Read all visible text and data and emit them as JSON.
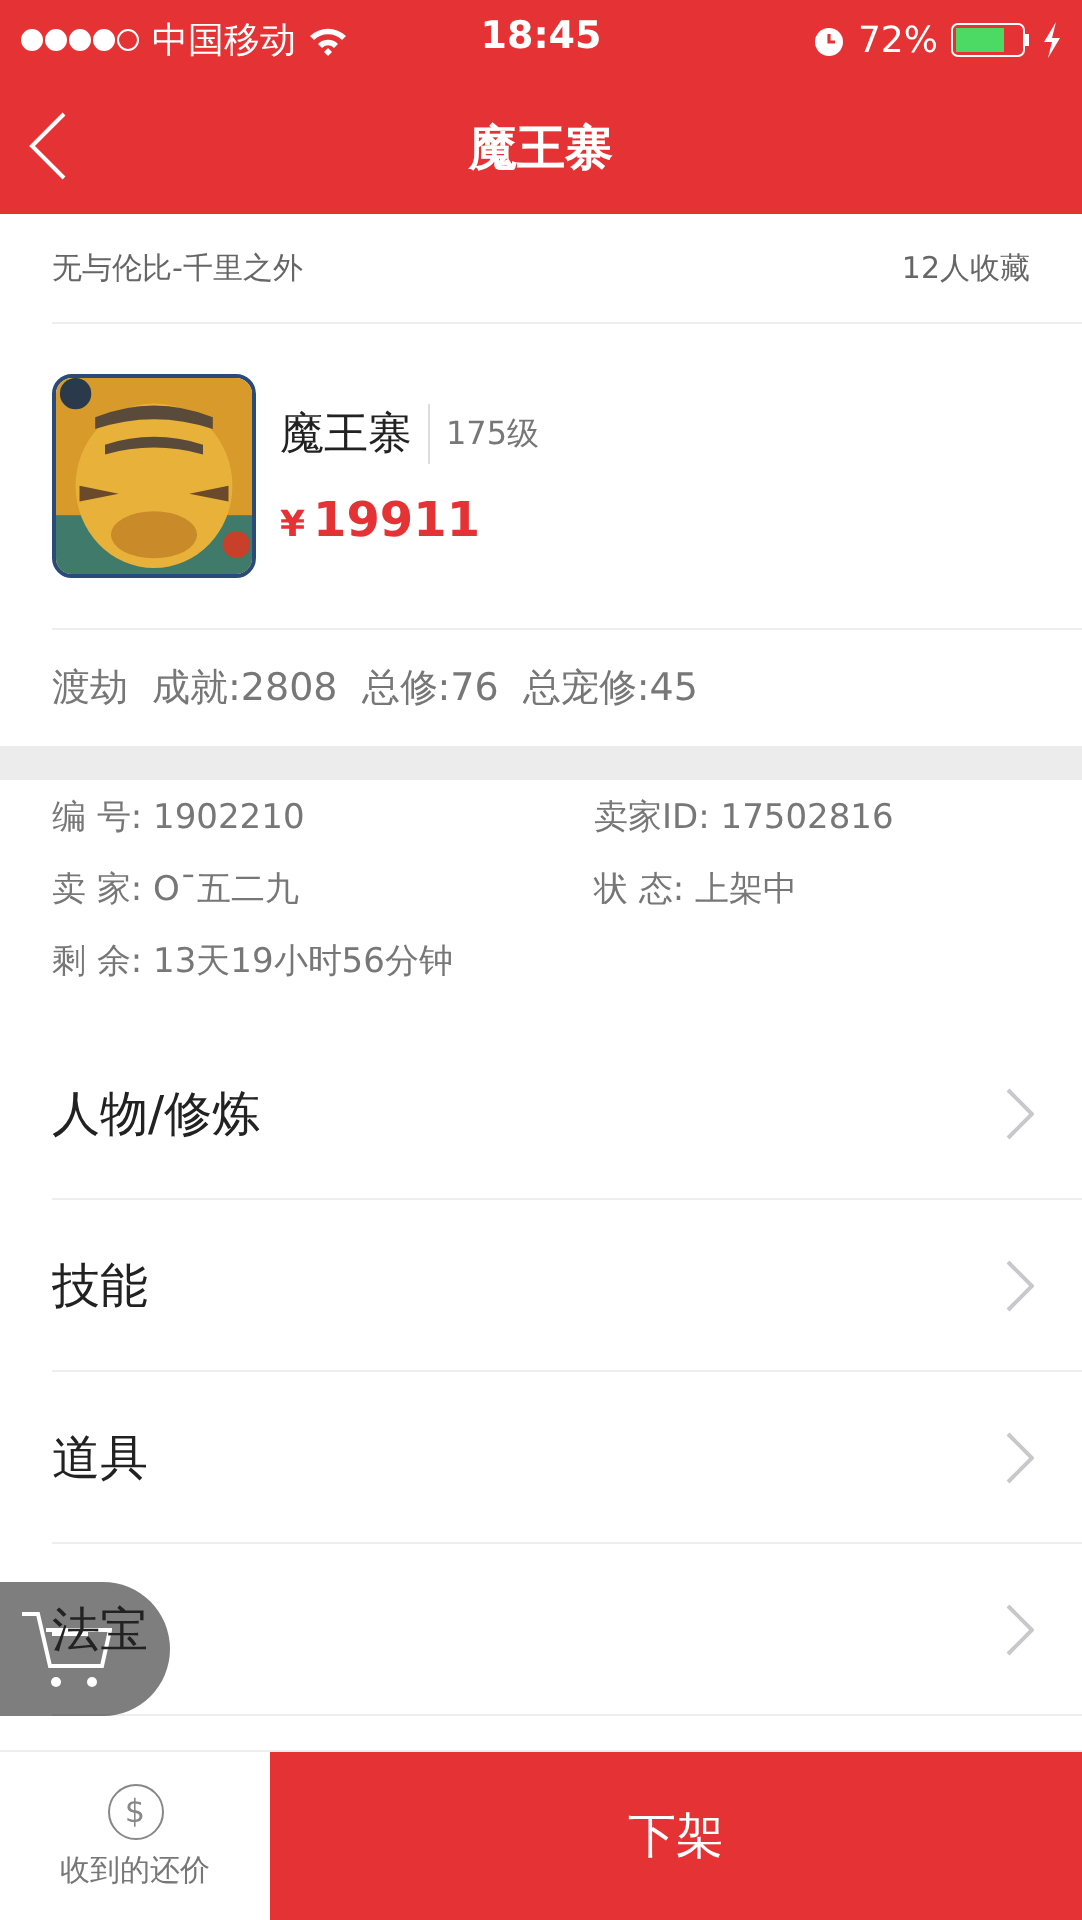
{
  "status_bar": {
    "carrier": "中国移动",
    "time": "18:45",
    "battery_percent": "72%"
  },
  "nav": {
    "title": "魔王寨"
  },
  "listing": {
    "server": "无与伦比-千里之外",
    "favorites": "12人收藏",
    "name": "魔王寨",
    "level": "175级",
    "price_symbol": "¥",
    "price": "19911",
    "stats": [
      "渡劫",
      "成就:2808",
      "总修:76",
      "总宠修:45"
    ]
  },
  "info": [
    {
      "label": "编 号:",
      "value": "1902210"
    },
    {
      "label": "卖家ID:",
      "value": "17502816"
    },
    {
      "label": "卖 家:",
      "value": "O¯五二九"
    },
    {
      "label": "状 态:",
      "value": "上架中"
    },
    {
      "label": "剩 余:",
      "value": "13天19小时56分钟"
    }
  ],
  "menu": [
    {
      "label": "人物/修炼"
    },
    {
      "label": "技能"
    },
    {
      "label": "道具"
    },
    {
      "label": "法宝"
    }
  ],
  "bottom_bar": {
    "offers_icon": "$",
    "offers_label": "收到的还价",
    "action": "下架"
  }
}
